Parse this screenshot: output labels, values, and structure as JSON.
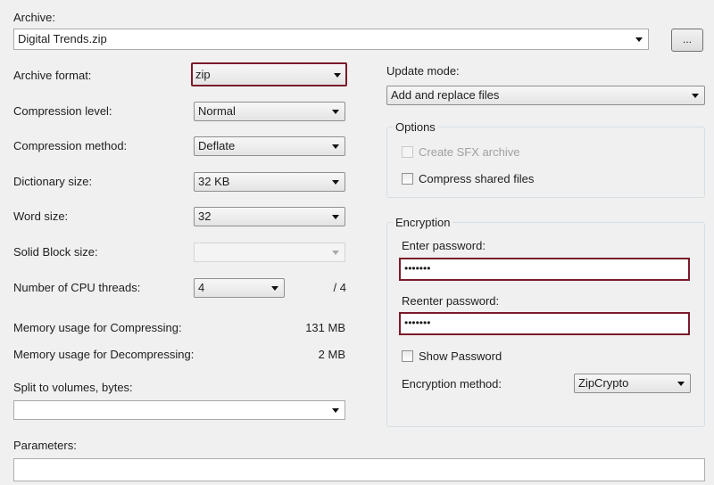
{
  "archive": {
    "label": "Archive:",
    "path": "Digital Trends.zip",
    "browse_label": "..."
  },
  "left": {
    "archive_format": {
      "label": "Archive format:",
      "value": "zip"
    },
    "compression_level": {
      "label": "Compression level:",
      "value": "Normal"
    },
    "compression_method": {
      "label": "Compression method:",
      "value": "Deflate"
    },
    "dictionary_size": {
      "label": "Dictionary size:",
      "value": "32 KB"
    },
    "word_size": {
      "label": "Word size:",
      "value": "32"
    },
    "solid_block_size": {
      "label": "Solid Block size:",
      "value": ""
    },
    "cpu_threads": {
      "label": "Number of CPU threads:",
      "value": "4",
      "max": "/ 4"
    },
    "memory_compress": {
      "label": "Memory usage for Compressing:",
      "value": "131 MB"
    },
    "memory_decompress": {
      "label": "Memory usage for Decompressing:",
      "value": "2 MB"
    },
    "split_volumes": {
      "label": "Split to volumes, bytes:",
      "value": ""
    },
    "parameters": {
      "label": "Parameters:",
      "value": ""
    }
  },
  "right": {
    "update_mode": {
      "label": "Update mode:",
      "value": "Add and replace files"
    },
    "options": {
      "title": "Options",
      "create_sfx": {
        "label": "Create SFX archive",
        "checked": false,
        "enabled": false
      },
      "compress_shared": {
        "label": "Compress shared files",
        "checked": false,
        "enabled": true
      }
    },
    "encryption": {
      "title": "Encryption",
      "enter_password": {
        "label": "Enter password:",
        "value": "•••••••"
      },
      "reenter_password": {
        "label": "Reenter password:",
        "value": "•••••••"
      },
      "show_password": {
        "label": "Show Password",
        "checked": false
      },
      "method": {
        "label": "Encryption method:",
        "value": "ZipCrypto"
      }
    }
  },
  "colors": {
    "highlight_border": "#7a1b2a",
    "window_bg": "#f0f0f0"
  }
}
